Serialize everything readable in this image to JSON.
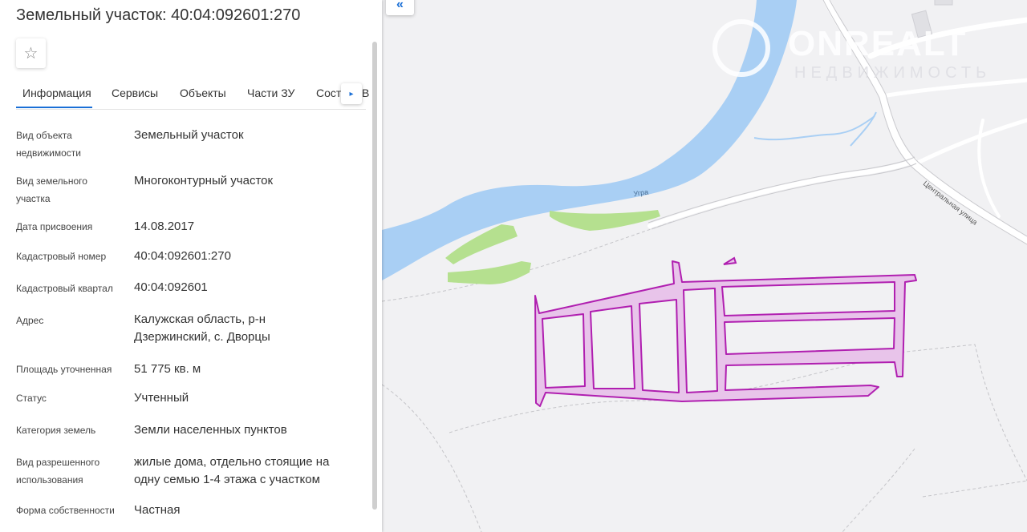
{
  "panel": {
    "title": "Земельный участок: 40:04:092601:270",
    "favorite_icon": "☆",
    "tabs": [
      {
        "label": "Информация"
      },
      {
        "label": "Сервисы"
      },
      {
        "label": "Объекты"
      },
      {
        "label": "Части ЗУ"
      },
      {
        "label": "Сост"
      }
    ],
    "tab_overflow_suffix": "В",
    "next_icon": "▸",
    "fields": [
      {
        "label": "Вид объекта недвижимости",
        "value": "Земельный участок"
      },
      {
        "label": "Вид земельного участка",
        "value": "Многоконтурный участок"
      },
      {
        "label": "Дата присвоения",
        "value": "14.08.2017"
      },
      {
        "label": "Кадастровый номер",
        "value": "40:04:092601:270"
      },
      {
        "label": "Кадастровый квартал",
        "value": "40:04:092601"
      },
      {
        "label": "Адрес",
        "value": "Калужская область, р-н Дзержинский, с. Дворцы"
      },
      {
        "label": "Площадь уточненная",
        "value": "51 775 кв. м"
      },
      {
        "label": "Статус",
        "value": "Учтенный"
      },
      {
        "label": "Категория земель",
        "value": "Земли населенных пунктов"
      },
      {
        "label": "Вид разрешенного использования",
        "value": "жилые дома, отдельно стоящие на одну семью 1-4 этажа с участком"
      },
      {
        "label": "Форма собственности",
        "value": "Частная"
      }
    ]
  },
  "map": {
    "collapse_icon": "«",
    "river_label": "Угра",
    "street_label": "Центральная улица",
    "watermark_main": "ONREALT",
    "watermark_sub": "недвижимость",
    "colors": {
      "river": "#a9cff4",
      "greenery": "#b5e08f",
      "parcel_stroke": "#b01fb0",
      "parcel_fill": "#e8c4ea",
      "road": "#ffffff",
      "accent": "#1a6fd6"
    }
  }
}
